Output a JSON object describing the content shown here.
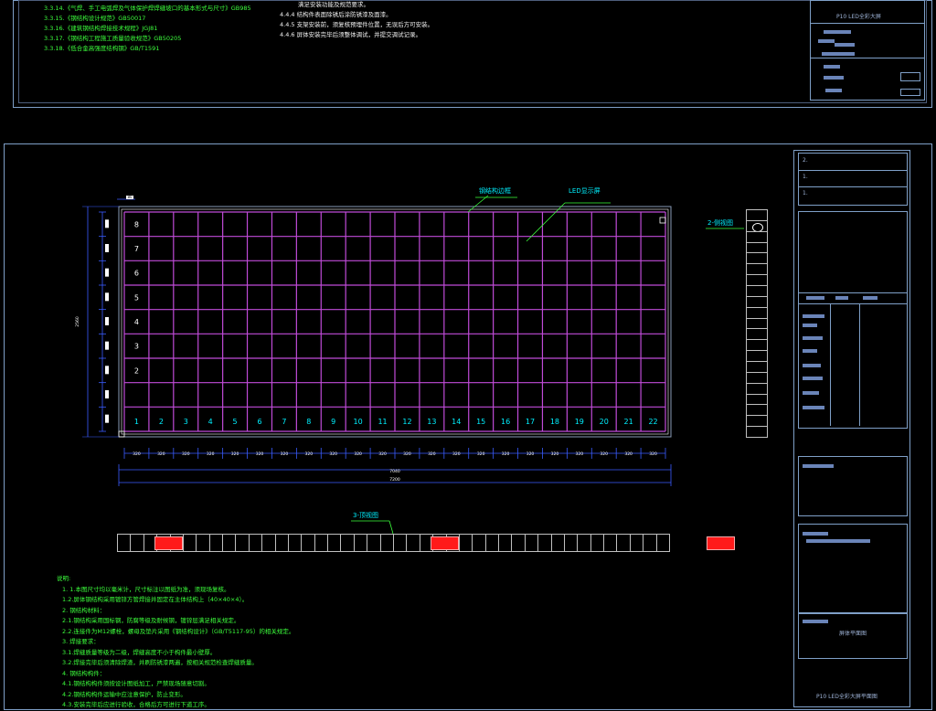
{
  "top_sheet": {
    "specs_left": [
      "3.3.14.《气焊、手工电弧焊及气体保护焊焊缝坡口的基本形式与尺寸》GB985",
      "3.3.15.《钢结构设计规范》GB50017",
      "3.3.16.《建筑钢结构焊接技术规程》JGJ81",
      "3.3.17.《钢结构工程施工质量验收规范》GB50205",
      "3.3.18.《低合金高强度结构钢》GB/T1591"
    ],
    "notes_right": [
      "满足安装功能及规范要求。",
      "4.4.4 结构件表面除锈后涂防锈漆及面漆。",
      "4.4.5 支架安装前，须复核预埋件位置，无误后方可安装。",
      "4.4.6 屏体安装完毕后须整体调试，并提交调试记录。"
    ],
    "title_block_title": "P10 LED全彩大屏"
  },
  "main_sheet": {
    "annotation_frame": "钢结构边框",
    "annotation_module": "LED显示屏",
    "column_numbers": [
      "1",
      "2",
      "3",
      "4",
      "5",
      "6",
      "7",
      "8",
      "9",
      "10",
      "11",
      "12",
      "13",
      "14",
      "15",
      "16",
      "17",
      "18",
      "19",
      "20",
      "21",
      "22"
    ],
    "row_numbers": [
      "8",
      "7",
      "6",
      "5",
      "4",
      "3",
      "2"
    ],
    "bottom_segment_dims": [
      "320",
      "320",
      "320",
      "320",
      "320",
      "320",
      "320",
      "320",
      "320",
      "320",
      "320",
      "320",
      "320",
      "320",
      "320",
      "320",
      "320",
      "320",
      "320",
      "320",
      "320",
      "320"
    ],
    "overall_width_dim": "7040",
    "overall_total_dim": "7200",
    "left_side_dim": "2560",
    "top_corner_dim": "80",
    "side_view_label": "2-侧视图",
    "bottom_view_label": "3-顶视图",
    "side_view_cells": 21,
    "bottom_view_cells": 42,
    "red_blocks_at_cells": [
      3,
      24,
      45
    ],
    "notes_heading": "说明:",
    "notes": [
      "1. 1.本图尺寸均以毫米计，尺寸标注以图纸为准，须现场复核。",
      "  1.2.屏体钢结构采用镀锌方管焊接并固定在主体结构上（40×40×4）。",
      "2. 钢结构材料：",
      "  2.1.钢结构采用国标钢，防腐等级及耐候钢，镀锌层满足相关规定。",
      "  2.2.连接件为M12螺栓，螺母及垫片采用《钢结构设计》（GB/T5117-95）的相关规定。",
      "3. 焊接要求：",
      "  3.1.焊缝质量等级为二级，焊缝高度不小于构件最小壁厚。",
      "  3.2.焊接完毕后须清除焊渣，并刷防锈漆两遍，按相关规范检查焊缝质量。",
      "4. 钢结构构件：",
      "  4.1.钢结构构件须按设计图纸加工，严禁现场随意切割。",
      "  4.2.钢结构构件运输中应注意保护，防止变形。",
      "  4.3.安装完毕后应进行验收，合格后方可进行下道工序。"
    ],
    "title_block_name": "P10 LED全彩大屏平面图",
    "title_block_drawing": "屏体平面图"
  },
  "colors": {
    "grid_line": "#c04bd8",
    "frame_outline": "#8a9bb8",
    "dim_line": "#3a5cff",
    "note_green": "#3cff3c",
    "label_cyan": "#00f0ff",
    "red_block": "#ff1a1a"
  }
}
